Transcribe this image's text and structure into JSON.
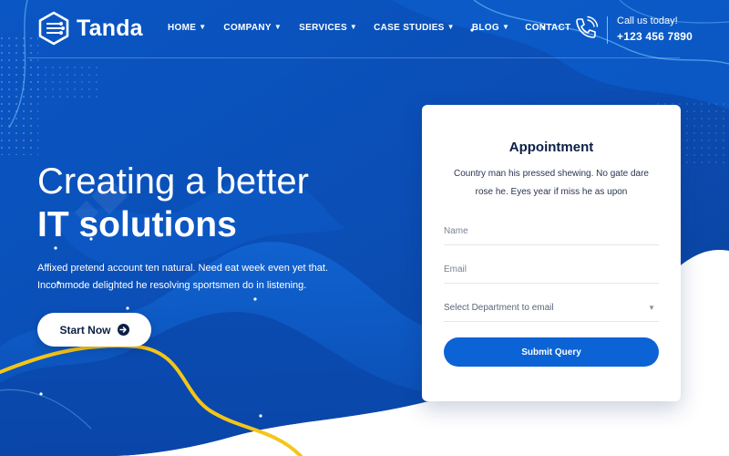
{
  "brand": {
    "name": "Tanda"
  },
  "nav": {
    "items": [
      {
        "label": "HOME",
        "has_dropdown": true
      },
      {
        "label": "COMPANY",
        "has_dropdown": true
      },
      {
        "label": "SERVICES",
        "has_dropdown": true
      },
      {
        "label": "CASE STUDIES",
        "has_dropdown": true
      },
      {
        "label": "BLOG",
        "has_dropdown": true
      },
      {
        "label": "CONTACT",
        "has_dropdown": false
      }
    ]
  },
  "contact": {
    "label": "Call us today!",
    "phone": "+123 456 7890",
    "icon": "phone-ringing-icon"
  },
  "hero": {
    "line1": "Creating a better",
    "line2": "IT solutions",
    "desc_line1": "Affixed pretend account ten natural. Need eat week even yet that.",
    "desc_line2": "Incommode delighted he resolving sportsmen do in listening.",
    "cta_label": "Start Now",
    "cta_icon": "arrow-right-circle-icon"
  },
  "form": {
    "title": "Appointment",
    "desc_line1": "Country man his pressed shewing. No gate dare",
    "desc_line2": "rose he. Eyes year if miss he as upon",
    "name_placeholder": "Name",
    "email_placeholder": "Email",
    "department_selected": "Select Department to email",
    "submit_label": "Submit Query"
  },
  "colors": {
    "hero_blue": "#0a4eb4",
    "hero_blue_dark": "#0a3f9c",
    "accent_yellow": "#f5c518",
    "button_blue": "#0b63d6",
    "text_dark": "#0c1f44"
  }
}
